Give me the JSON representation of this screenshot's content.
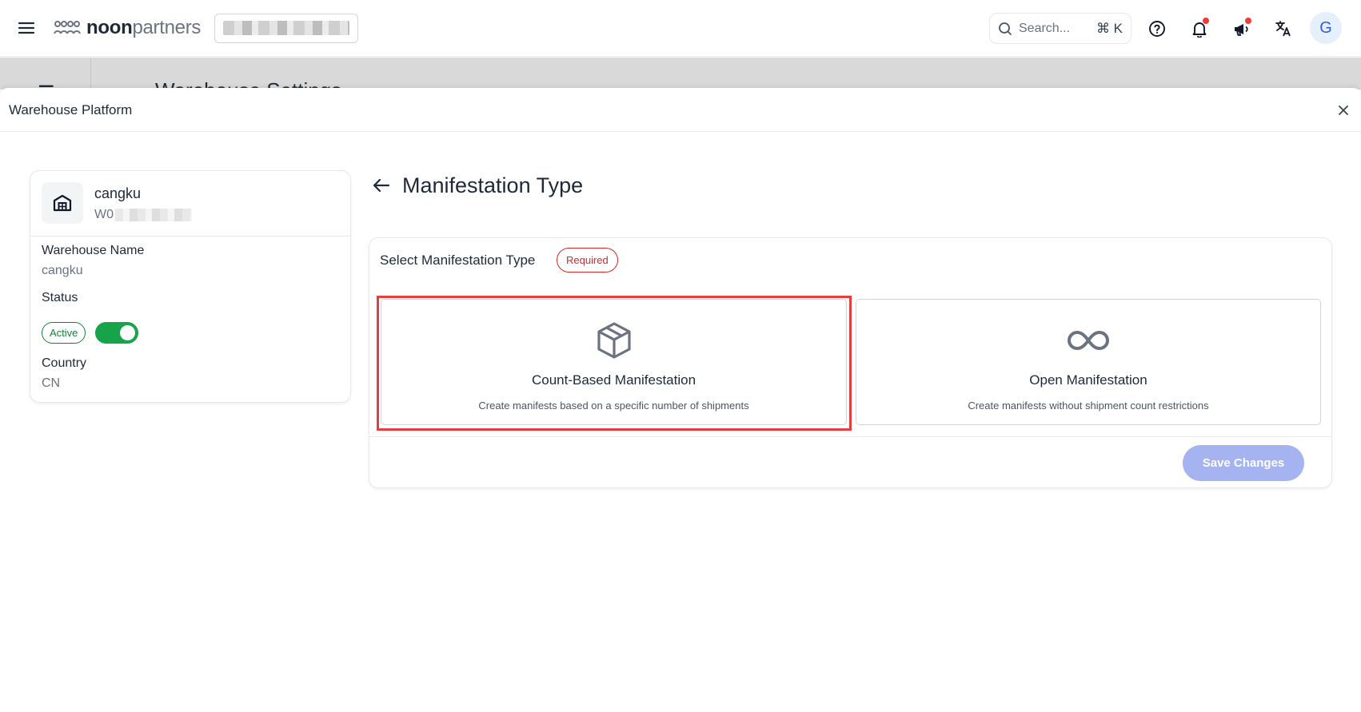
{
  "topbar": {
    "logo_bold": "noon",
    "logo_light": "partners",
    "search_placeholder": "Search...",
    "search_shortcut": "⌘ K",
    "avatar_initial": "G"
  },
  "background_page": {
    "title": "Warehouse Settings"
  },
  "modal": {
    "title": "Warehouse Platform"
  },
  "warehouse": {
    "name": "cangku",
    "code_prefix": "W0",
    "fields": {
      "name_label": "Warehouse Name",
      "name_value": "cangku",
      "status_label": "Status",
      "status_badge": "Active",
      "status_enabled": true,
      "country_label": "Country",
      "country_value": "CN"
    }
  },
  "manifestation": {
    "page_title": "Manifestation Type",
    "select_label": "Select Manifestation Type",
    "required_badge": "Required",
    "options": [
      {
        "title": "Count-Based Manifestation",
        "description": "Create manifests based on a specific number of shipments",
        "icon": "box-icon",
        "highlighted": true
      },
      {
        "title": "Open Manifestation",
        "description": "Create manifests without shipment count restrictions",
        "icon": "infinity-icon",
        "highlighted": false
      }
    ],
    "save_label": "Save Changes"
  },
  "colors": {
    "accent_green": "#16a34a",
    "required_red": "#dc2626",
    "highlight_red": "#e53e3e",
    "save_disabled": "#a5b4f0",
    "avatar_blue": "#2f5fdc"
  }
}
